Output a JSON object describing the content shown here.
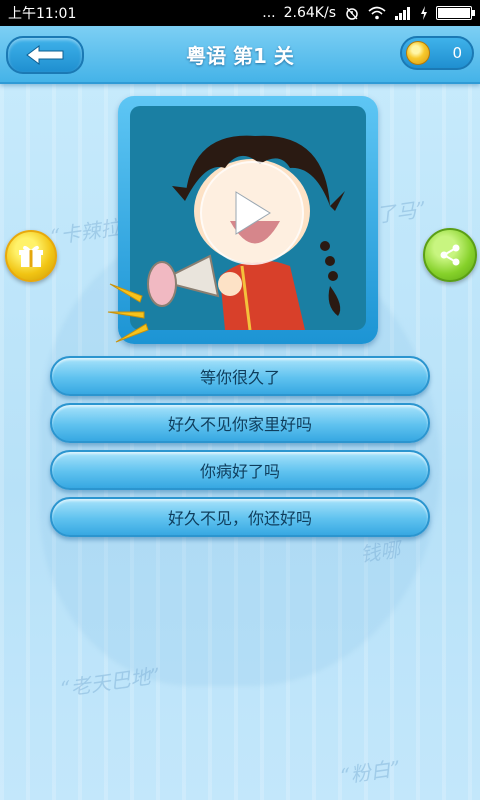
{
  "status_bar": {
    "time": "上午11:01",
    "dots": "...",
    "speed": "2.64K/s",
    "battery_level": 1.0
  },
  "header": {
    "title": "粤语  第1 关",
    "coin_count": "0"
  },
  "watermarks": [
    "“卡辣拉",
    "了马”",
    "“老天巴地”",
    "“粉白”",
    "钱哪"
  ],
  "answers": [
    "等你很久了",
    "好久不见你家里好吗",
    "你病好了吗",
    "好久不见，你还好吗"
  ],
  "colors": {
    "header": "#45b3e8",
    "answer_button": "#5fc2ef",
    "gift": "#f1c413",
    "share": "#86d12a"
  },
  "icons": [
    "back-arrow-icon",
    "coin-icon",
    "gift-icon",
    "share-icon",
    "play-icon",
    "megaphone-icon"
  ]
}
